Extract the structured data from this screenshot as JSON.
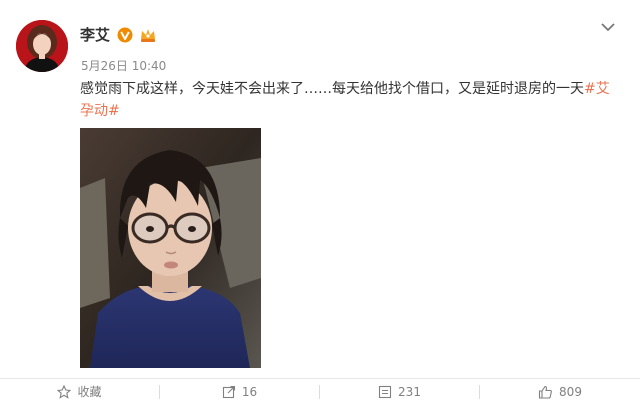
{
  "post": {
    "username": "李艾",
    "timestamp": "5月26日 10:40",
    "text": "感觉雨下成这样，今天娃不会出来了……每天给他找个借口，又是延时退房的一天",
    "hashtag": "#艾孕动#"
  },
  "badges": {
    "verified_icon": "verified-v-icon",
    "member_icon": "member-crown-icon",
    "verified_color": "#f08a00"
  },
  "actions": {
    "favorite_label": "收藏",
    "repost_count": "16",
    "comment_count": "231",
    "like_count": "809"
  },
  "colors": {
    "hashtag": "#eb7350",
    "text": "#333333",
    "meta": "#8a8a8a"
  }
}
